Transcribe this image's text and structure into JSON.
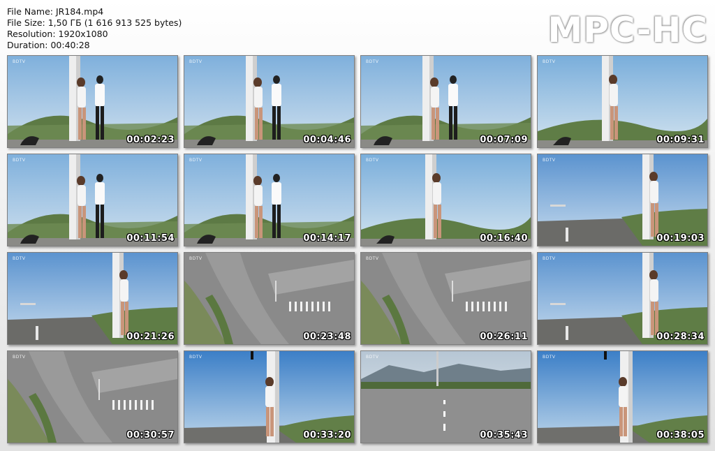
{
  "info": {
    "file_name": "File Name: JR184.mp4",
    "file_size": "File Size: 1,50 ГБ (1 616 913 525 bytes)",
    "resolution": "Resolution: 1920x1080",
    "duration": "Duration: 00:40:28"
  },
  "logo": "MPC-HC",
  "watermark": "BDTV",
  "thumbnails": [
    {
      "timestamp": "00:02:23",
      "scene": "pole-two"
    },
    {
      "timestamp": "00:04:46",
      "scene": "pole-two"
    },
    {
      "timestamp": "00:07:09",
      "scene": "pole-two"
    },
    {
      "timestamp": "00:09:31",
      "scene": "pole-one"
    },
    {
      "timestamp": "00:11:54",
      "scene": "pole-two"
    },
    {
      "timestamp": "00:14:17",
      "scene": "pole-two"
    },
    {
      "timestamp": "00:16:40",
      "scene": "pole-one"
    },
    {
      "timestamp": "00:19:03",
      "scene": "road-pole"
    },
    {
      "timestamp": "00:21:26",
      "scene": "road-pole"
    },
    {
      "timestamp": "00:23:48",
      "scene": "aerial"
    },
    {
      "timestamp": "00:26:11",
      "scene": "aerial"
    },
    {
      "timestamp": "00:28:34",
      "scene": "road-pole"
    },
    {
      "timestamp": "00:30:57",
      "scene": "aerial"
    },
    {
      "timestamp": "00:33:20",
      "scene": "traffic-pole"
    },
    {
      "timestamp": "00:35:43",
      "scene": "road-wide"
    },
    {
      "timestamp": "00:38:05",
      "scene": "traffic-pole"
    }
  ]
}
